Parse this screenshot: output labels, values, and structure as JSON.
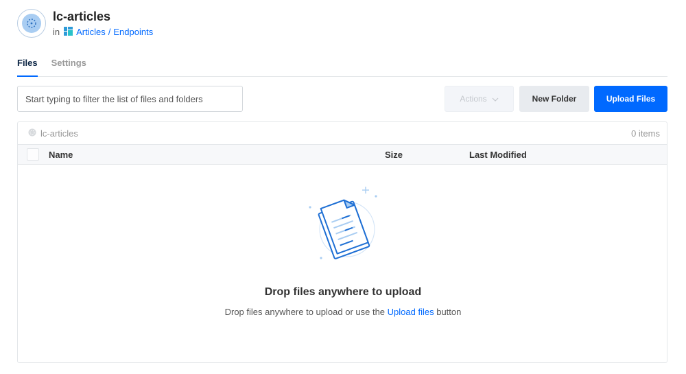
{
  "header": {
    "title": "lc-articles",
    "in_label": "in",
    "project": "Articles",
    "separator": "/",
    "section": "Endpoints"
  },
  "tabs": [
    {
      "label": "Files",
      "active": true
    },
    {
      "label": "Settings",
      "active": false
    }
  ],
  "toolbar": {
    "filter_placeholder": "Start typing to filter the list of files and folders",
    "actions_label": "Actions",
    "new_folder_label": "New Folder",
    "upload_label": "Upload Files"
  },
  "panel": {
    "bucket_name": "lc-articles",
    "item_count": "0 items",
    "columns": {
      "name": "Name",
      "size": "Size",
      "last_modified": "Last Modified"
    }
  },
  "empty_state": {
    "title": "Drop files anywhere to upload",
    "sub_before": "Drop files anywhere to upload or use the",
    "sub_link": "Upload files",
    "sub_after": "button"
  },
  "colors": {
    "accent": "#0069ff",
    "icon_fill": "#a9cdf2"
  },
  "icons": [
    "bucket-icon",
    "project-icon",
    "chevron-down-icon",
    "bucket-small-icon",
    "files-illustration-icon"
  ]
}
